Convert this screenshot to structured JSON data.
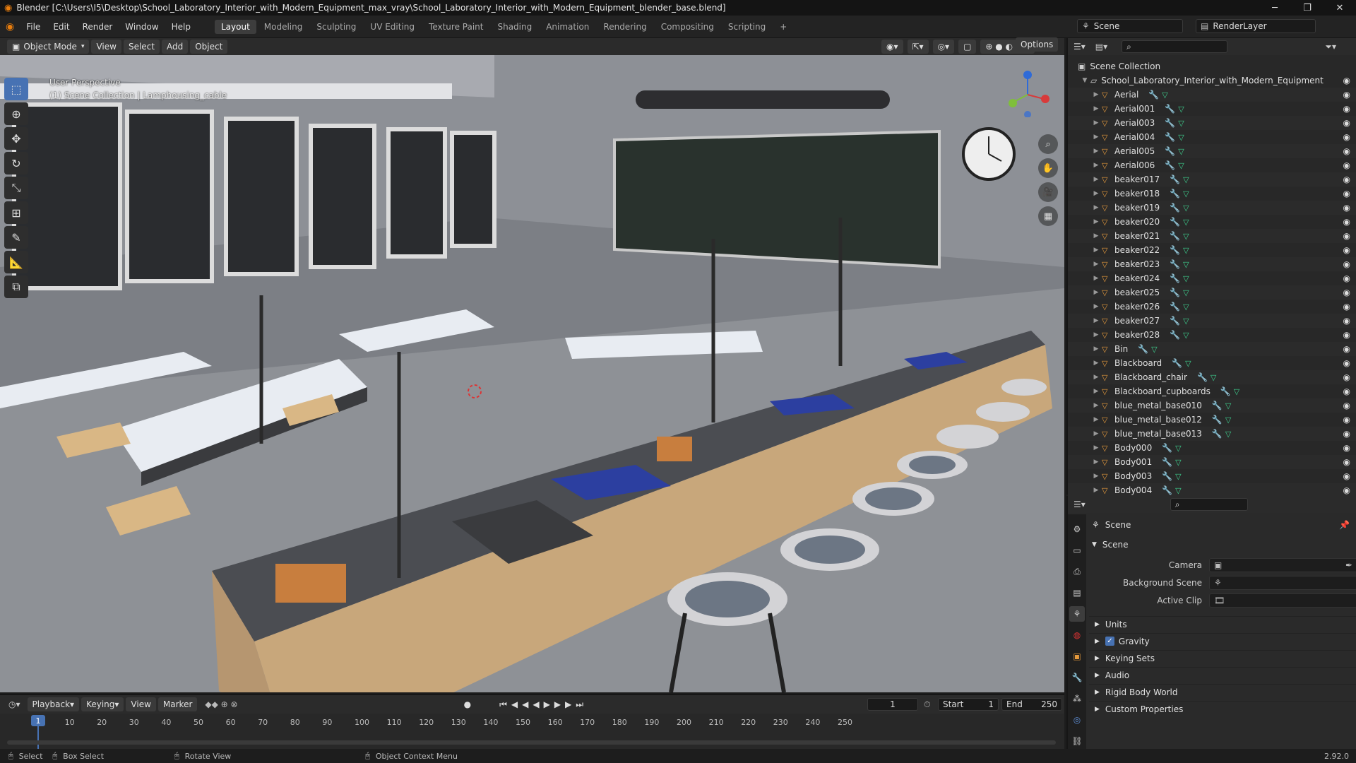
{
  "window": {
    "title": "Blender [C:\\Users\\I5\\Desktop\\School_Laboratory_Interior_with_Modern_Equipment_max_vray\\School_Laboratory_Interior_with_Modern_Equipment_blender_base.blend]"
  },
  "menu": [
    "File",
    "Edit",
    "Render",
    "Window",
    "Help"
  ],
  "workspaces": [
    "Layout",
    "Modeling",
    "Sculpting",
    "UV Editing",
    "Texture Paint",
    "Shading",
    "Animation",
    "Rendering",
    "Compositing",
    "Scripting"
  ],
  "scene_name": "Scene",
  "view_layer": "RenderLayer",
  "header": {
    "mode": "Object Mode",
    "view": "View",
    "select": "Select",
    "add": "Add",
    "object": "Object",
    "orientation": "Global",
    "options": "Options"
  },
  "viewport": {
    "perspective": "User Perspective",
    "collection_info": "(1) Scene Collection | Lamphousing_cable"
  },
  "outliner": {
    "root": "Scene Collection",
    "collection": "School_Laboratory_Interior_with_Modern_Equipment",
    "items": [
      "Aerial",
      "Aerial001",
      "Aerial003",
      "Aerial004",
      "Aerial005",
      "Aerial006",
      "beaker017",
      "beaker018",
      "beaker019",
      "beaker020",
      "beaker021",
      "beaker022",
      "beaker023",
      "beaker024",
      "beaker025",
      "beaker026",
      "beaker027",
      "beaker028",
      "Bin",
      "Blackboard",
      "Blackboard_chair",
      "Blackboard_cupboards",
      "blue_metal_base010",
      "blue_metal_base012",
      "blue_metal_base013",
      "Body000",
      "Body001",
      "Body003",
      "Body004"
    ]
  },
  "properties": {
    "context": "Scene",
    "section": "Scene",
    "camera_label": "Camera",
    "bg_scene_label": "Background Scene",
    "active_clip_label": "Active Clip",
    "panels": [
      "Units",
      "Gravity",
      "Keying Sets",
      "Audio",
      "Rigid Body World",
      "Custom Properties"
    ],
    "gravity_checked": true
  },
  "timeline": {
    "playback": "Playback",
    "keying": "Keying",
    "view": "View",
    "marker": "Marker",
    "current_frame": "1",
    "start_label": "Start",
    "start": "1",
    "end_label": "End",
    "end": "250",
    "ticks": [
      "1",
      "10",
      "20",
      "30",
      "40",
      "50",
      "60",
      "70",
      "80",
      "90",
      "100",
      "110",
      "120",
      "130",
      "140",
      "150",
      "160",
      "170",
      "180",
      "190",
      "200",
      "210",
      "220",
      "230",
      "240",
      "250"
    ]
  },
  "status": {
    "select": "Select",
    "box_select": "Box Select",
    "rotate_view": "Rotate View",
    "context_menu": "Object Context Menu",
    "version": "2.92.0"
  },
  "colors": {
    "accent": "#4772b3",
    "object_orange": "#e69a3c",
    "mesh_green": "#3ecf8e",
    "bench_wood": "#c8a77b",
    "bench_top": "#4b4d52",
    "bench_blue": "#2c3fa0"
  }
}
